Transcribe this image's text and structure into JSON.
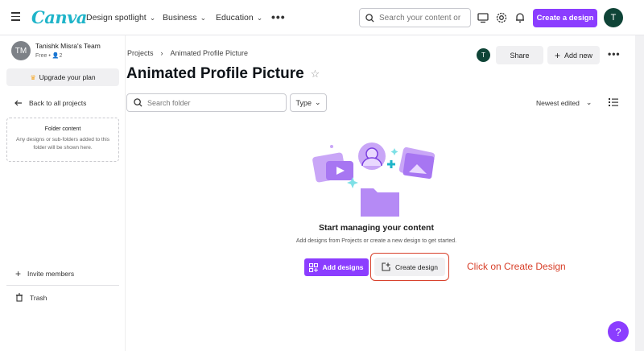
{
  "topbar": {
    "logo": "Canva",
    "nav": [
      {
        "label": "Design spotlight"
      },
      {
        "label": "Business"
      },
      {
        "label": "Education"
      }
    ],
    "search_placeholder": "Search your content or",
    "create_label": "Create a design",
    "user_initial": "T"
  },
  "sidebar": {
    "team_initials": "TM",
    "team_name": "Tanishk Misra's Team",
    "team_plan": "Free",
    "team_members": "2",
    "upgrade_label": "Upgrade your plan",
    "back_label": "Back to all projects",
    "folder_title": "Folder content",
    "folder_text": "Any designs or sub-folders added to this folder will be shown here.",
    "invite_label": "Invite members",
    "trash_label": "Trash"
  },
  "main": {
    "breadcrumb": {
      "root": "Projects",
      "current": "Animated Profile Picture"
    },
    "title": "Animated Profile Picture",
    "folder_search_placeholder": "Search folder",
    "type_label": "Type",
    "sort_label": "Newest edited",
    "owner_initial": "T",
    "share_label": "Share",
    "addnew_label": "Add new",
    "empty_title": "Start managing your content",
    "empty_subtitle": "Add designs from Projects or create a new design to get started.",
    "add_designs_label": "Add designs",
    "create_design_label": "Create design",
    "annotation": "Click on Create Design",
    "help_label": "?"
  },
  "colors": {
    "accent": "#8b3dff",
    "logo": "#1fb4c9",
    "avatar": "#0f4437",
    "annotation": "#d8402a"
  }
}
